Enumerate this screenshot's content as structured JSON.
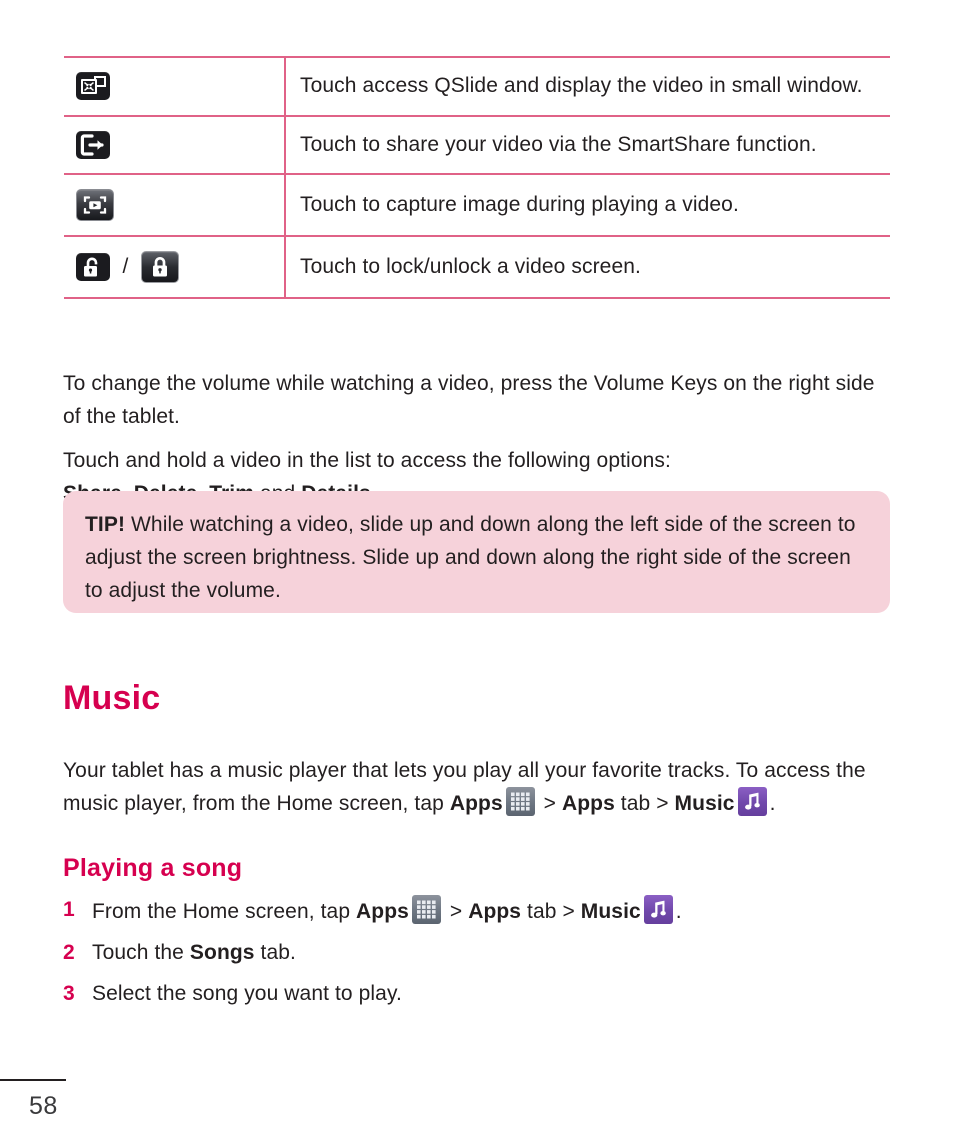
{
  "table": {
    "rows": [
      {
        "icons": [
          {
            "name": "qslide-icon",
            "kind": "qslide"
          }
        ],
        "description": "Touch access QSlide and display the video in small window."
      },
      {
        "icons": [
          {
            "name": "smartshare-icon",
            "kind": "share"
          }
        ],
        "description": "Touch to share your video via the SmartShare function."
      },
      {
        "icons": [
          {
            "name": "capture-image-icon",
            "kind": "capture"
          }
        ],
        "description": "Touch to capture image during playing a video."
      },
      {
        "icons": [
          {
            "name": "unlock-icon",
            "kind": "lock-open"
          },
          {
            "name": "lock-icon",
            "kind": "lock-closed"
          }
        ],
        "separator": "/",
        "description": "Touch to lock/unlock a video screen."
      }
    ]
  },
  "paragraphs": {
    "volume": "To change the volume while watching a video, press the Volume Keys on the right side of the tablet.",
    "touch_hold_intro": "Touch and hold a video in the list to access the following options:",
    "option_share": "Share",
    "option_comma1": ", ",
    "option_delete": "Delete",
    "option_comma2": ", ",
    "option_trim": "Trim",
    "option_and": " and ",
    "option_details": "Details",
    "option_period": "."
  },
  "tip": {
    "label": "TIP!",
    "text": " While watching a video, slide up and down along the left side of the screen to adjust the screen brightness. Slide up and down along the right side of the screen to adjust the volume."
  },
  "music_section": {
    "heading": "Music",
    "intro_part1": "Your tablet has a music player that lets you play all your favorite tracks. To access the music player, from the Home screen, tap ",
    "apps_bold": "Apps",
    "gt1": " > ",
    "apps_bold2": "Apps",
    "tab_word": " tab > ",
    "music_bold": "Music",
    "period": "."
  },
  "playing_section": {
    "heading": "Playing a song",
    "steps": [
      {
        "number": "1",
        "prefix": "From the Home screen, tap ",
        "bold1": "Apps",
        "mid1": " > ",
        "bold2": "Apps",
        "mid2": " tab > ",
        "bold3": "Music",
        "suffix": "."
      },
      {
        "number": "2",
        "prefix": "Touch the ",
        "bold1": "Songs",
        "suffix": " tab."
      },
      {
        "number": "3",
        "prefix": "Select the song you want to play.",
        "suffix": ""
      }
    ]
  },
  "footer": {
    "page_number": "58"
  },
  "colors": {
    "accent_heading": "#d6004f",
    "table_rule": "#e06287",
    "tip_background": "#f6d2da",
    "body_text": "#231f20",
    "music_icon": "#7048ab",
    "apps_icon": "#6d7682"
  }
}
